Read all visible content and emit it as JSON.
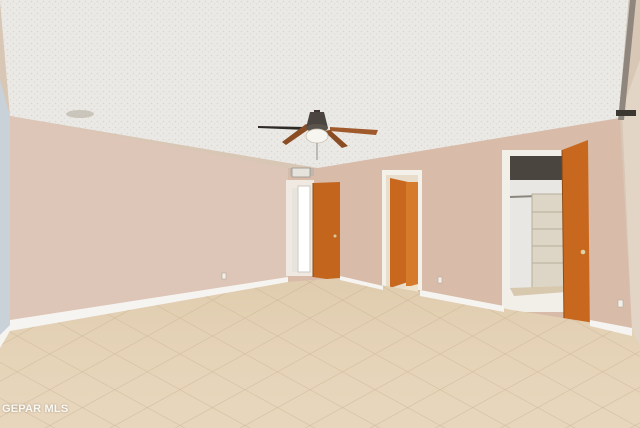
{
  "photo": {
    "watermark": "GEPAR MLS",
    "colors": {
      "ceiling": "#eceae6",
      "wall": "#dcc0b0",
      "door": "#c8681e",
      "floor_tile": "#e2ceb0",
      "baseboard": "#f4f1ec",
      "closet_dresser": "#ddd6c6"
    }
  }
}
